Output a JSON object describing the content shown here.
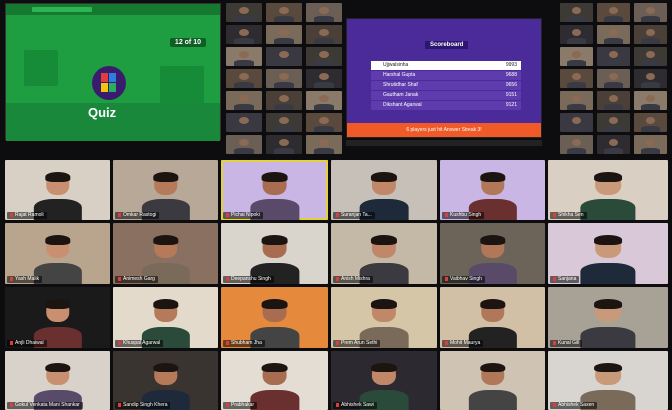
{
  "quiz_share": {
    "counter": "12 of 10",
    "logo_text": "Quiz",
    "bg_color": "#1f9d41"
  },
  "leaderboard": {
    "title": "Scoreboard",
    "rows": [
      {
        "name": "Ujjwalsinha",
        "score": "9993"
      },
      {
        "name": "Harshal Gupta",
        "score": "9688"
      },
      {
        "name": "Shrutidhar Shaf",
        "score": "9656"
      },
      {
        "name": "Gautham Janak",
        "score": "9151"
      },
      {
        "name": "Dikshant Agarwal",
        "score": "9121"
      }
    ],
    "banner": "6 players just hit Answer Streak 3!",
    "bg_color": "#4b2a9a"
  },
  "tiles": [
    {
      "label": "Rajat Ramoli"
    },
    {
      "label": "Omkar Rastogi"
    },
    {
      "label": "Pichai Nipoki"
    },
    {
      "label": "Suranjan Ta..."
    },
    {
      "label": "Kushbu Singh"
    },
    {
      "label": "Shikha Sen"
    },
    {
      "label": "Yash Malik"
    },
    {
      "label": "Animesh Garg"
    },
    {
      "label": "Deepanshu Singh"
    },
    {
      "label": "Anish Mishra"
    },
    {
      "label": "Vaibhav Singh"
    },
    {
      "label": "Sanjana"
    },
    {
      "label": "Anjli Dhaiwal"
    },
    {
      "label": "Khuspal Agarwal"
    },
    {
      "label": "Shubham Jha"
    },
    {
      "label": "Prem Arun Sethi"
    },
    {
      "label": "Mohit Maurya"
    },
    {
      "label": "Kunal Gill"
    },
    {
      "label": "Gokul Venkata Mani Shankar"
    },
    {
      "label": "Sandip Singh Khera"
    },
    {
      "label": "Prabhakar"
    },
    {
      "label": "Abhishek Sawi"
    },
    {
      "label": ""
    },
    {
      "label": "Abhishek Saxen"
    }
  ]
}
